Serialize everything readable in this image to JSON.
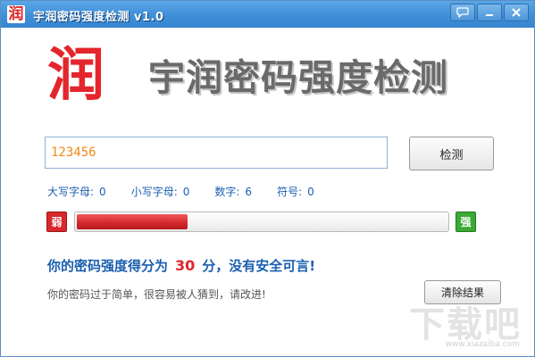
{
  "window": {
    "icon_char": "润",
    "title": "宇润密码强度检测 v1.0",
    "buttons": [
      "chat-icon",
      "minimize-icon",
      "close-icon"
    ]
  },
  "logo": {
    "char": "润",
    "title": "宇润密码强度检测"
  },
  "input": {
    "value": "123456"
  },
  "check_button": "检测",
  "stats": [
    {
      "label": "大写字母:",
      "value": "0"
    },
    {
      "label": "小写字母:",
      "value": "0"
    },
    {
      "label": "数字:",
      "value": "6"
    },
    {
      "label": "符号:",
      "value": "0"
    }
  ],
  "strength": {
    "weak_label": "弱",
    "strong_label": "强",
    "percent": 30,
    "fill_color": "#d1262a"
  },
  "result": {
    "prefix": "你的密码强度得分为",
    "score": "30",
    "suffix": "分，没有安全可言!"
  },
  "advice": "你的密码过于简单，很容易被人猜到，请改进!",
  "clear_button": "清除结果",
  "watermark": {
    "text": "下载吧",
    "sub": "www.xiazaiba.com"
  }
}
